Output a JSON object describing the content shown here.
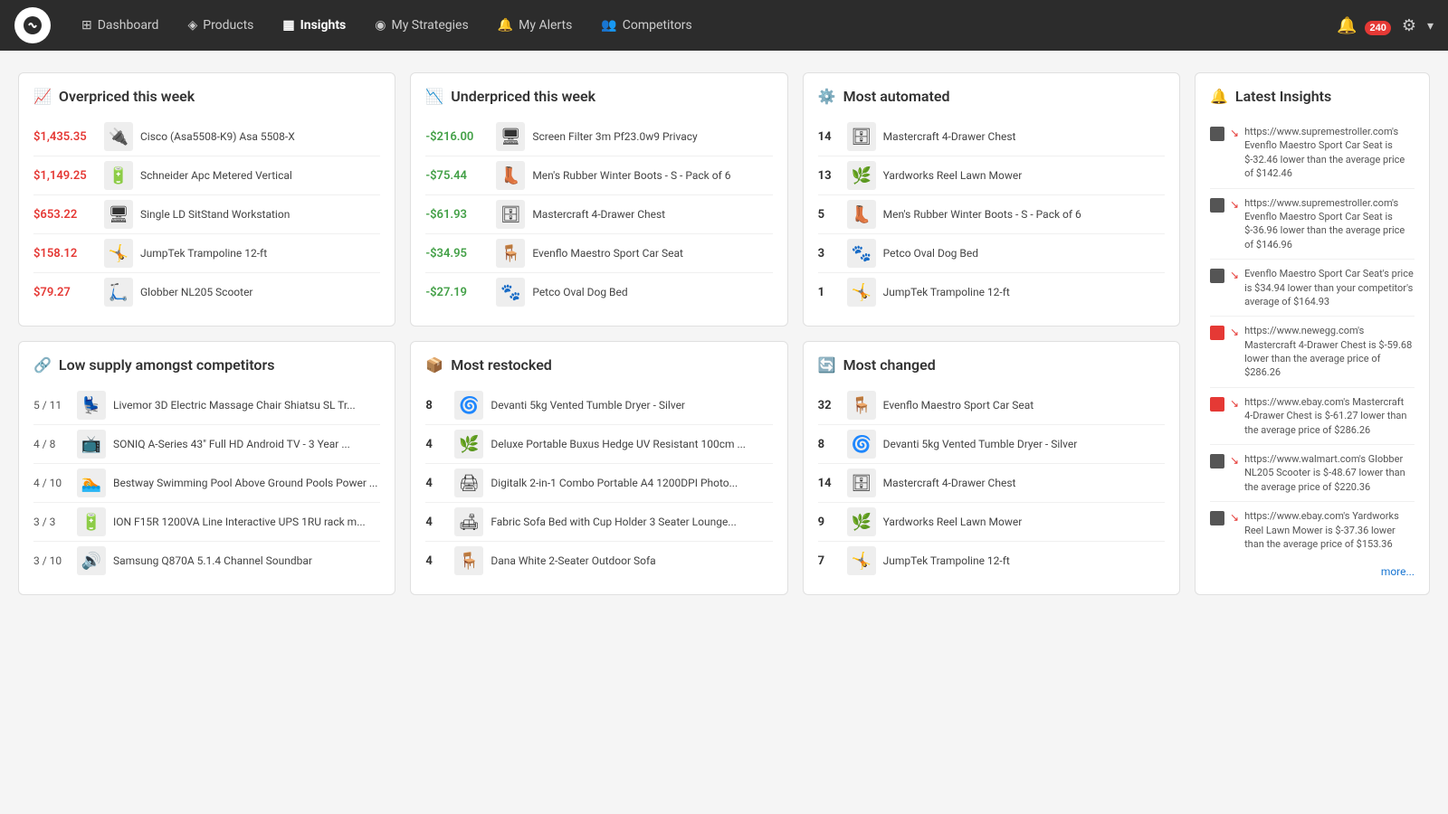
{
  "nav": {
    "logo_alt": "Logo",
    "links": [
      {
        "label": "Dashboard",
        "icon": "⊞",
        "active": false,
        "name": "dashboard"
      },
      {
        "label": "Products",
        "icon": "◈",
        "active": false,
        "name": "products"
      },
      {
        "label": "Insights",
        "icon": "▦",
        "active": true,
        "name": "insights"
      },
      {
        "label": "My Strategies",
        "icon": "◉",
        "active": false,
        "name": "strategies"
      },
      {
        "label": "My Alerts",
        "icon": "🔔",
        "active": false,
        "name": "alerts"
      },
      {
        "label": "Competitors",
        "icon": "👥",
        "active": false,
        "name": "competitors"
      }
    ],
    "alert_count": "240",
    "gear_label": "⚙",
    "chevron_label": "▾"
  },
  "overpriced": {
    "title": "Overpriced this week",
    "icon": "📈",
    "items": [
      {
        "price": "$1,435.35",
        "name": "Cisco (Asa5508-K9) Asa 5508-X",
        "thumb": "🔌"
      },
      {
        "price": "$1,149.25",
        "name": "Schneider Apc Metered Vertical",
        "thumb": "🔋"
      },
      {
        "price": "$653.22",
        "name": "Single LD SitStand Workstation",
        "thumb": "🖥"
      },
      {
        "price": "$158.12",
        "name": "JumpTek Trampoline 12-ft",
        "thumb": "🤸"
      },
      {
        "price": "$79.27",
        "name": "Globber NL205 Scooter",
        "thumb": "🛴"
      }
    ]
  },
  "underpriced": {
    "title": "Underpriced this week",
    "icon": "📉",
    "items": [
      {
        "price": "-$216.00",
        "name": "Screen Filter 3m Pf23.0w9 Privacy",
        "thumb": "🖥"
      },
      {
        "price": "-$75.44",
        "name": "Men's Rubber Winter Boots - S - Pack of 6",
        "thumb": "👢"
      },
      {
        "price": "-$61.93",
        "name": "Mastercraft 4-Drawer Chest",
        "thumb": "🗄"
      },
      {
        "price": "-$34.95",
        "name": "Evenflo Maestro Sport Car Seat",
        "thumb": "🪑"
      },
      {
        "price": "-$27.19",
        "name": "Petco Oval Dog Bed",
        "thumb": "🐾"
      }
    ]
  },
  "automated": {
    "title": "Most automated",
    "icon": "⚙",
    "items": [
      {
        "count": "14",
        "name": "Mastercraft 4-Drawer Chest",
        "thumb": "🗄"
      },
      {
        "count": "13",
        "name": "Yardworks Reel Lawn Mower",
        "thumb": "🌿"
      },
      {
        "count": "5",
        "name": "Men's Rubber Winter Boots - S - Pack of 6",
        "thumb": "👢"
      },
      {
        "count": "3",
        "name": "Petco Oval Dog Bed",
        "thumb": "🐾"
      },
      {
        "count": "1",
        "name": "JumpTek Trampoline 12-ft",
        "thumb": "🤸"
      }
    ]
  },
  "low_supply": {
    "title": "Low supply amongst competitors",
    "icon": "🔗",
    "items": [
      {
        "supply": "5 / 11",
        "name": "Livemor 3D Electric Massage Chair Shiatsu SL Tr...",
        "thumb": "💺"
      },
      {
        "supply": "4 / 8",
        "name": "SONIQ A-Series 43\" Full HD Android TV - 3 Year ...",
        "thumb": "📺"
      },
      {
        "supply": "4 / 10",
        "name": "Bestway Swimming Pool Above Ground Pools Power ...",
        "thumb": "🏊"
      },
      {
        "supply": "3 / 3",
        "name": "ION F15R 1200VA Line Interactive UPS 1RU rack m...",
        "thumb": "🔋"
      },
      {
        "supply": "3 / 10",
        "name": "Samsung Q870A 5.1.4 Channel Soundbar",
        "thumb": "🔊"
      }
    ]
  },
  "restocked": {
    "title": "Most restocked",
    "icon": "📦",
    "items": [
      {
        "count": "8",
        "name": "Devanti 5kg Vented Tumble Dryer - Silver",
        "thumb": "🌀"
      },
      {
        "count": "4",
        "name": "Deluxe Portable Buxus Hedge UV Resistant 100cm ...",
        "thumb": "🌿"
      },
      {
        "count": "4",
        "name": "Digitalk 2-in-1 Combo Portable A4 1200DPI Photo...",
        "thumb": "🖨"
      },
      {
        "count": "4",
        "name": "Fabric Sofa Bed with Cup Holder 3 Seater Lounge...",
        "thumb": "🛋"
      },
      {
        "count": "4",
        "name": "Dana White 2-Seater Outdoor Sofa",
        "thumb": "🪑"
      }
    ]
  },
  "changed": {
    "title": "Most changed",
    "icon": "🔄",
    "items": [
      {
        "count": "32",
        "name": "Evenflo Maestro Sport Car Seat",
        "thumb": "🪑"
      },
      {
        "count": "8",
        "name": "Devanti 5kg Vented Tumble Dryer - Silver",
        "thumb": "🌀"
      },
      {
        "count": "14",
        "name": "Mastercraft 4-Drawer Chest",
        "thumb": "🗄"
      },
      {
        "count": "9",
        "name": "Yardworks Reel Lawn Mower",
        "thumb": "🌿"
      },
      {
        "count": "7",
        "name": "JumpTek Trampoline 12-ft",
        "thumb": "🤸"
      }
    ]
  },
  "insights": {
    "title": "Latest Insights",
    "more_label": "more...",
    "entries": [
      {
        "site": "supremestroller.com",
        "text": "https://www.supremestroller.com's Evenflo Maestro Sport Car Seat is $-32.46 lower than the average price of $142.46",
        "color": "dark"
      },
      {
        "site": "supremestroller.com",
        "text": "https://www.supremestroller.com's Evenflo Maestro Sport Car Seat is $-36.96 lower than the average price of $146.96",
        "color": "dark"
      },
      {
        "site": "general",
        "text": "Evenflo Maestro Sport Car Seat's price is $34.94 lower than your competitor's average of $164.93",
        "color": "dark"
      },
      {
        "site": "newegg.com",
        "text": "https://www.newegg.com's Mastercraft 4-Drawer Chest is $-59.68 lower than the average price of $286.26",
        "color": "red"
      },
      {
        "site": "ebay.com",
        "text": "https://www.ebay.com's Mastercraft 4-Drawer Chest is $-61.27 lower than the average price of $286.26",
        "color": "red"
      },
      {
        "site": "walmart.com",
        "text": "https://www.walmart.com's Globber NL205 Scooter is $-48.67 lower than the average price of $220.36",
        "color": "dark"
      },
      {
        "site": "ebay.com",
        "text": "https://www.ebay.com's Yardworks Reel Lawn Mower is $-37.36 lower than the average price of $153.36",
        "color": "dark"
      }
    ]
  }
}
